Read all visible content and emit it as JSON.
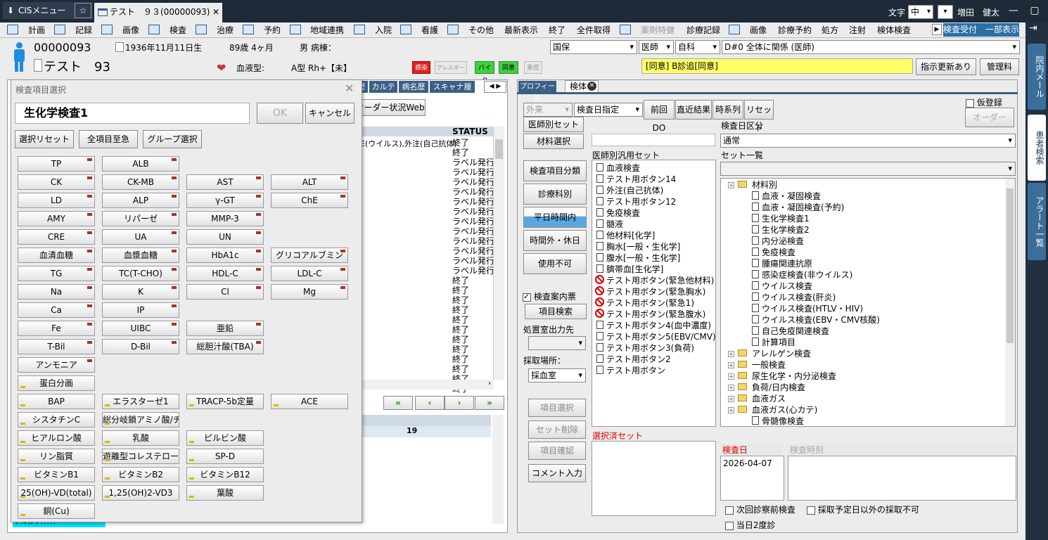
{
  "titlebar": {
    "app_tab": "CISメニュー",
    "patient_tab": "テスト　９３(00000093)",
    "font_label": "文字",
    "font_size": "中",
    "user": "増田　健太"
  },
  "menu": {
    "items": [
      "計画",
      "記録",
      "画像",
      "検査",
      "治療",
      "予約",
      "地域連携",
      "入院",
      "看護",
      "その他",
      "最新表示",
      "終了",
      "全件取得",
      "薬剤特健",
      "診療記録",
      "画像",
      "診療予約",
      "処方",
      "注射",
      "検体検査"
    ],
    "right_button": "検査受付　一部表示"
  },
  "patient": {
    "id": "00000093",
    "birth": "1936年11月11日生",
    "age": "89歳 4ヶ月",
    "sex_label": "男 病棟：",
    "name": "テスト　93",
    "blood_label": "血液型:",
    "blood_value": "A型 Rh+【未】",
    "badge_infect": "感染",
    "badge_allergy": "アレルギー",
    "badge_baita": "バイタ",
    "badge_consent": "同意",
    "badge_rest": "重症"
  },
  "insurance": {
    "type": "国保",
    "doctor": "医師",
    "dept": "自科",
    "disease": "D#0 全体に関係 (医師)",
    "consent_box": "[同意] B診追[同意]",
    "btn_update": "指示更新あり",
    "btn_admin": "管理料"
  },
  "left_tabs": [
    "歴",
    "カルテ",
    "病名歴",
    "スキャナ履歴"
  ],
  "left_panel": {
    "order_web": "オーダー状況Web",
    "status_header": "STATUS",
    "first_row_text": "E(ウイルス),外注(自己抗体)",
    "statuses": [
      "終了",
      "終了",
      "ラベル発行",
      "ラベル発行",
      "ラベル発行",
      "ラベル発行",
      "ラベル発行",
      "ラベル発行",
      "ラベル発行",
      "ラベル発行",
      "ラベル発行",
      "ラベル発行",
      "ラベル発行",
      "ラベル発行",
      "終了",
      "終了",
      "終了",
      "終了",
      "終了",
      "終了",
      "終了",
      "終了",
      "終了",
      "終了",
      "終了",
      "終了"
    ],
    "count": "19",
    "bottom_item": "アルカリ?????"
  },
  "dialog": {
    "title": "検査項目選択",
    "category": "生化学検査1",
    "ok": "OK",
    "cancel": "キャンセル",
    "btn_reset": "選択リセット",
    "btn_urgent": "全項目至急",
    "btn_group": "グループ選択",
    "items": [
      [
        "TP",
        "ALB",
        "",
        ""
      ],
      [
        "CK",
        "CK-MB",
        "AST",
        "ALT"
      ],
      [
        "LD",
        "ALP",
        "γ-GT",
        "ChE"
      ],
      [
        "AMY",
        "リパーゼ",
        "MMP-3",
        ""
      ],
      [
        "CRE",
        "UA",
        "UN",
        ""
      ],
      [
        "血清血糖",
        "血漿血糖",
        "HbA1c",
        "グリコアルブミン"
      ],
      [
        "TG",
        "TC(T-CHO)",
        "HDL-C",
        "LDL-C"
      ],
      [
        "Na",
        "K",
        "Cl",
        "Mg"
      ],
      [
        "Ca",
        "IP",
        "",
        ""
      ],
      [
        "Fe",
        "UIBC",
        "亜鉛",
        ""
      ],
      [
        "T-Bil",
        "D-Bil",
        "総胆汁酸(TBA)",
        ""
      ],
      [
        "アンモニア",
        "",
        "",
        ""
      ],
      [
        "蛋白分画",
        "",
        "",
        ""
      ],
      [
        "BAP",
        "エラスターゼ1",
        "TRACP-5b定量",
        "ACE"
      ],
      [
        "シスタチンC",
        "総分岐鎖アミノ酸/チロシ",
        "",
        ""
      ],
      [
        "ヒアルロン酸",
        "乳酸",
        "ピルビン酸",
        ""
      ],
      [
        "リン脂質",
        "遊離型コレステロール",
        "SP-D",
        ""
      ],
      [
        "ビタミンB1",
        "ビタミンB2",
        "ビタミンB12",
        ""
      ],
      [
        "25(OH)-VD(total)",
        "1,25(OH)2-VD3",
        "葉酸",
        ""
      ],
      [
        "銅(Cu)",
        "",
        "",
        ""
      ]
    ]
  },
  "right_tabs": {
    "profile": "プロフィール",
    "exam": "検体"
  },
  "right_panel": {
    "visit": "外来",
    "date_mode": "検査日指定",
    "btn_prev": "前回DO",
    "btn_recent": "直近結果",
    "btn_timeline": "時系列",
    "btn_reset": "リセット",
    "kari": "仮登録",
    "order": "オーダー",
    "btn_doctor_set": "医師別セット",
    "btn_material": "材料選択",
    "btn_exam_class": "検査項目分類",
    "btn_dept": "診療科別",
    "btn_weekday": "平日時間内",
    "btn_offhours": "時間外・休日",
    "btn_disabled": "使用不可",
    "chk_guide": "検査案内票",
    "btn_item_search": "項目検索",
    "room_label": "処置室出力先",
    "place_label": "採取場所：",
    "place_value": "採血室",
    "btn_item_select": "項目選択",
    "btn_set_delete": "セット削除",
    "btn_item_confirm": "項目確認",
    "btn_comment": "コメント入力",
    "doctor_set_title": "医師別汎用セット",
    "doctor_sets": [
      [
        "血液検査",
        0
      ],
      [
        "テスト用ボタン14",
        0
      ],
      [
        "外注(自己抗体)",
        0
      ],
      [
        "テスト用ボタン12",
        0
      ],
      [
        "免疫検査",
        0
      ],
      [
        "髄液",
        0
      ],
      [
        "他材料[化学]",
        0
      ],
      [
        "胸水[一般・生化学]",
        0
      ],
      [
        "腹水[一般・生化学]",
        0
      ],
      [
        "臍帯血[生化学]",
        0
      ],
      [
        "テスト用ボタン(緊急他材料)",
        1
      ],
      [
        "テスト用ボタン(緊急胸水)",
        1
      ],
      [
        "テスト用ボタン(緊急1)",
        1
      ],
      [
        "テスト用ボタン(緊急腹水)",
        1
      ],
      [
        "テスト用ボタン4(血中濃度)",
        0
      ],
      [
        "テスト用ボタン5(EBV/CMV)",
        0
      ],
      [
        "テスト用ボタン3(負荷)",
        0
      ],
      [
        "テスト用ボタン2",
        0
      ],
      [
        "テスト用ボタン",
        0
      ]
    ],
    "date_type_label": "検査日区分",
    "date_type": "通常",
    "set_list_label": "セット一覧",
    "tree": [
      [
        "材料別",
        0,
        1
      ],
      [
        "血液・凝固検査",
        1,
        0
      ],
      [
        "血液・凝固検査(予約)",
        1,
        0
      ],
      [
        "生化学検査1",
        1,
        0
      ],
      [
        "生化学検査2",
        1,
        0
      ],
      [
        "内分泌検査",
        1,
        0
      ],
      [
        "免疫検査",
        1,
        0
      ],
      [
        "腫瘍関連抗原",
        1,
        0
      ],
      [
        "感染症検査(非ウイルス)",
        1,
        0
      ],
      [
        "ウイルス検査",
        1,
        0
      ],
      [
        "ウイルス検査(肝炎)",
        1,
        0
      ],
      [
        "ウイルス検査(HTLV・HIV)",
        1,
        0
      ],
      [
        "ウイルス検査(EBV・CMV核酸)",
        1,
        0
      ],
      [
        "自己免疫関連検査",
        1,
        0
      ],
      [
        "計算項目",
        1,
        0
      ],
      [
        "アレルゲン検査",
        0,
        1
      ],
      [
        "一般検査",
        0,
        1
      ],
      [
        "尿生化学・内分泌検査",
        0,
        1
      ],
      [
        "負荷/日内検査",
        0,
        1
      ],
      [
        "血液ガス",
        0,
        1
      ],
      [
        "血液ガス(心カテ)",
        0,
        1
      ],
      [
        "骨髄像検査",
        1,
        0
      ]
    ],
    "selected_set_label": "選択済セット",
    "exam_date_label": "検査日",
    "exam_time_label": "検査時刻",
    "exam_date": "2026-04-07",
    "chk_next": "次回診察前検査",
    "chk_only": "採取予定日以外の採取不可",
    "chk_twice": "当日2度診"
  },
  "sidebar": {
    "tab1": "院内メール",
    "tab2": "患者検索",
    "tab3": "アラート一覧"
  }
}
